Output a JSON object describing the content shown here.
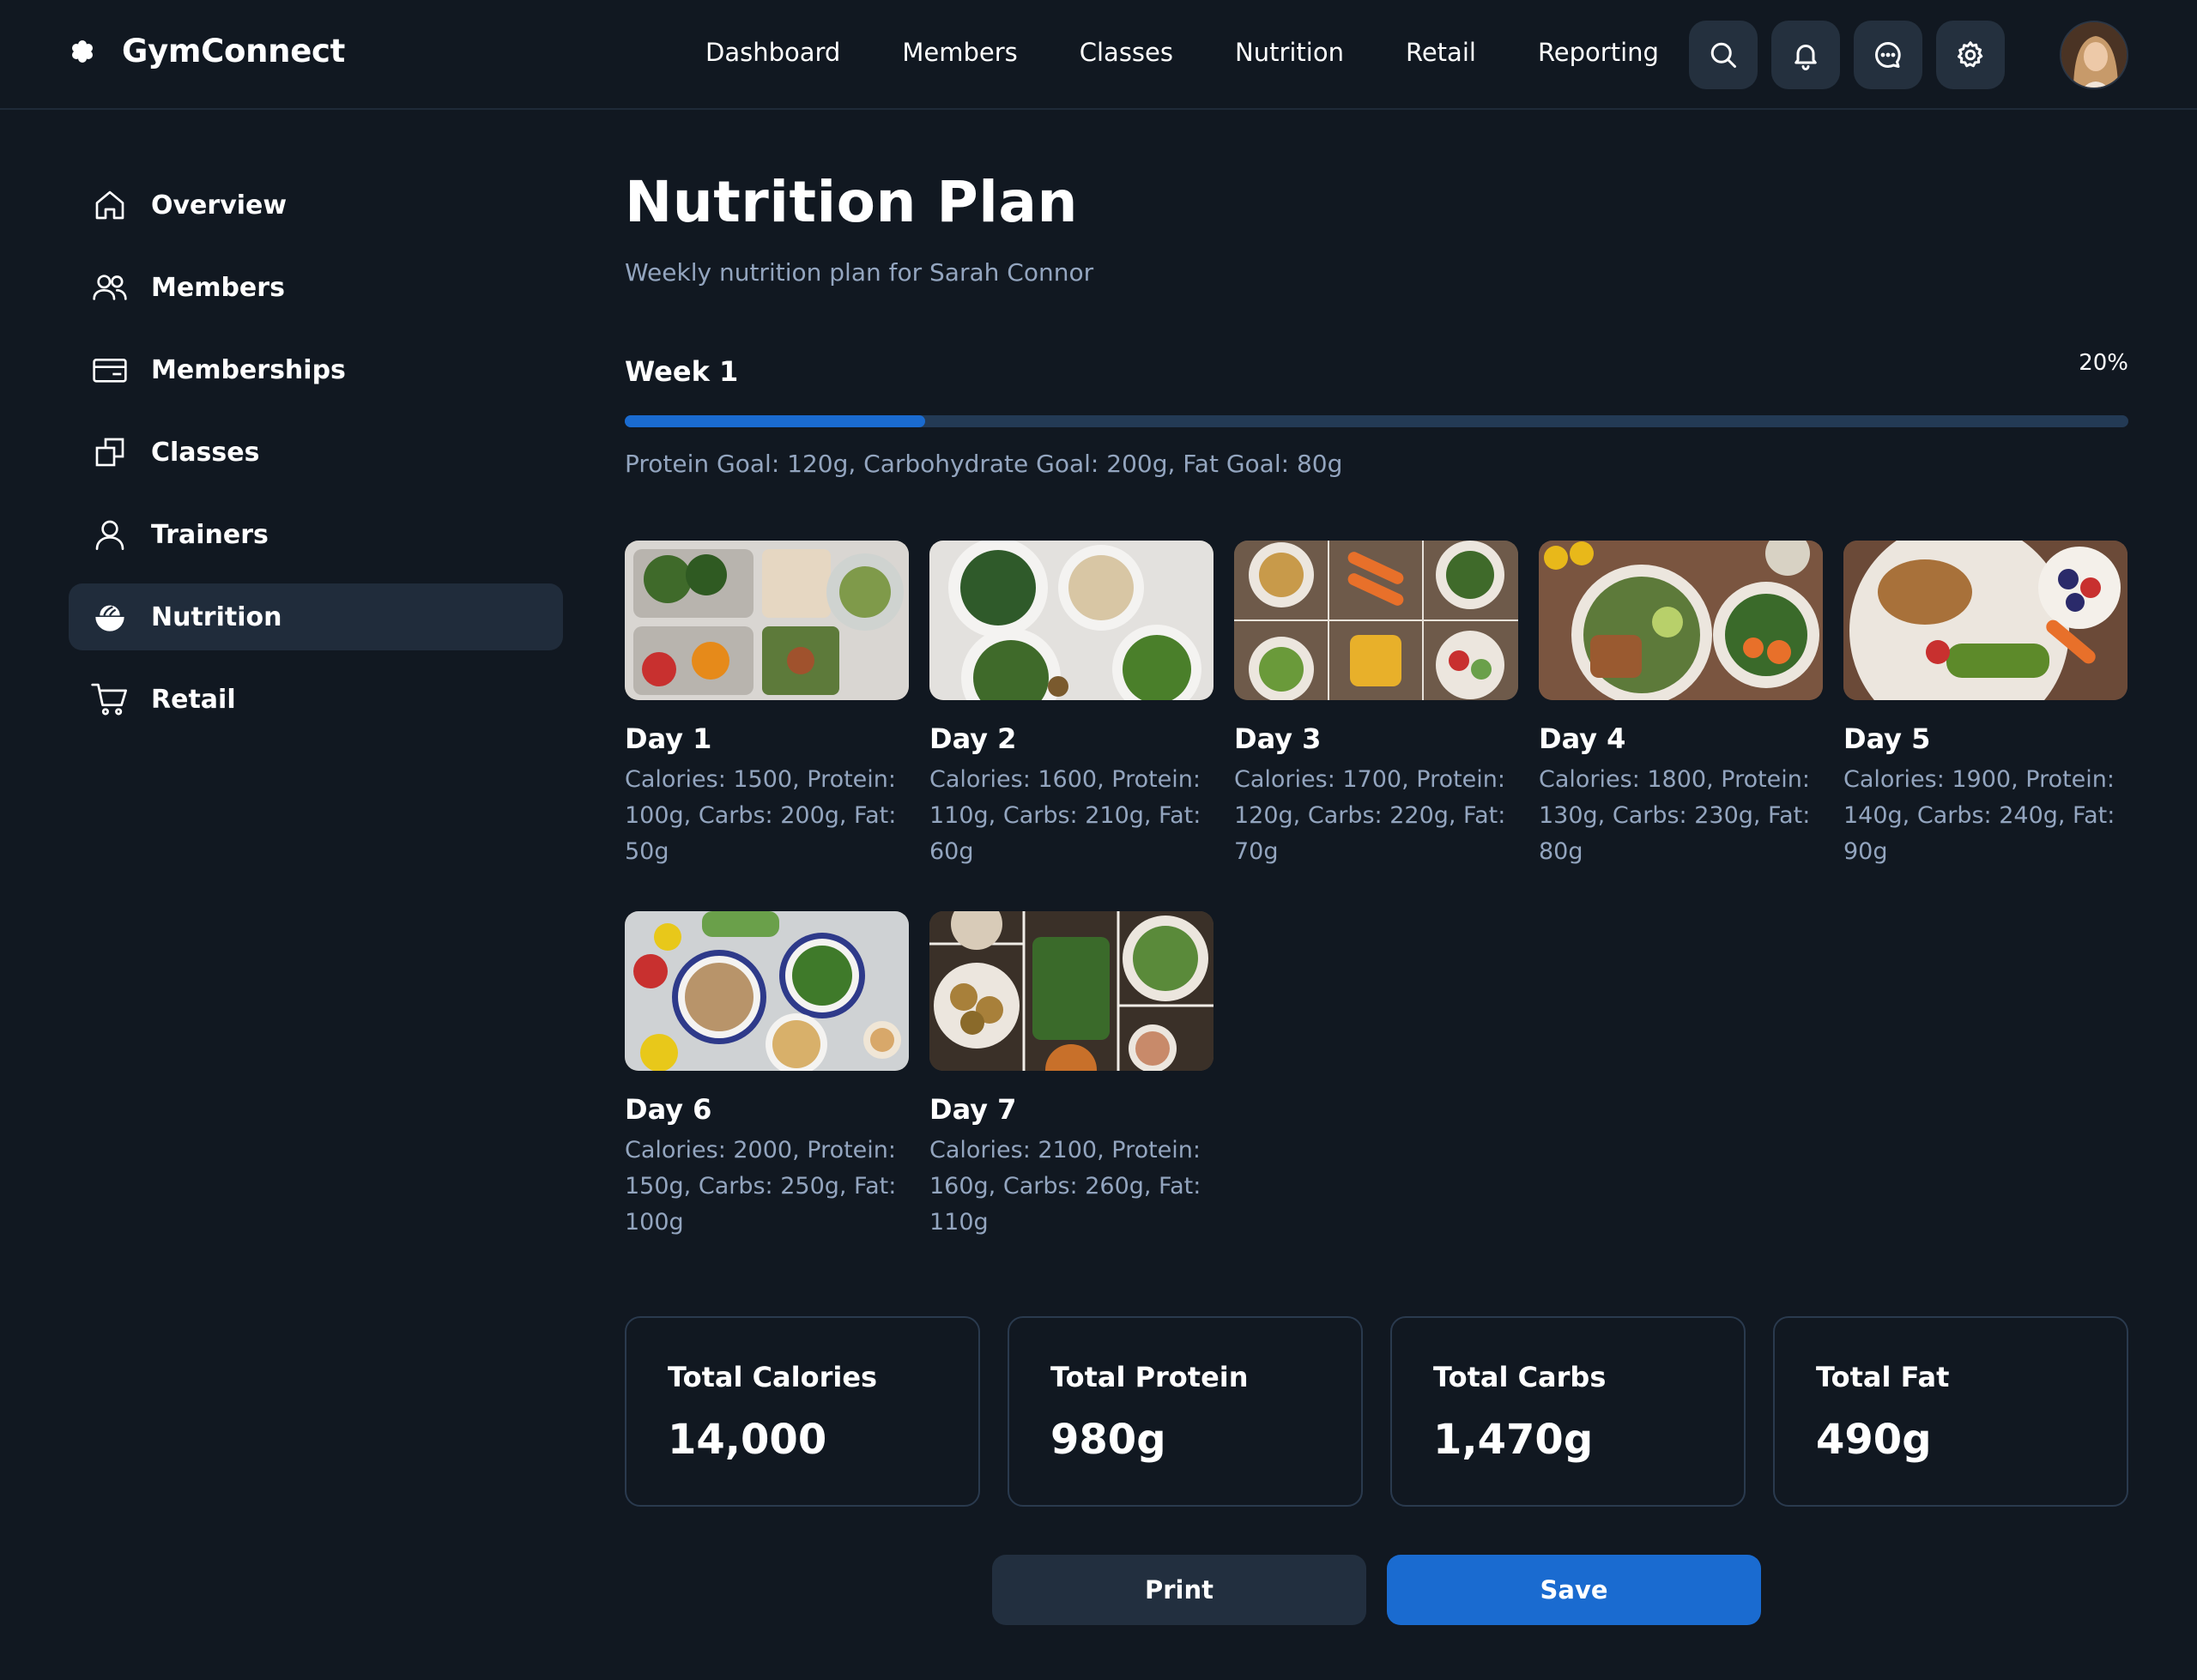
{
  "app": {
    "name": "GymConnect",
    "logo_icon": "asterisk-icon"
  },
  "topnav": [
    {
      "label": "Dashboard"
    },
    {
      "label": "Members"
    },
    {
      "label": "Classes"
    },
    {
      "label": "Nutrition"
    },
    {
      "label": "Retail"
    },
    {
      "label": "Reporting"
    }
  ],
  "topbar_actions": [
    "search-icon",
    "bell-icon",
    "chat-icon",
    "gear-icon"
  ],
  "sidebar": {
    "items": [
      {
        "label": "Overview",
        "icon": "home-icon"
      },
      {
        "label": "Members",
        "icon": "users-icon"
      },
      {
        "label": "Memberships",
        "icon": "card-icon"
      },
      {
        "label": "Classes",
        "icon": "copy-icon"
      },
      {
        "label": "Trainers",
        "icon": "user-icon"
      },
      {
        "label": "Nutrition",
        "icon": "bowl-icon",
        "active": true
      },
      {
        "label": "Retail",
        "icon": "cart-icon"
      }
    ]
  },
  "page": {
    "title": "Nutrition Plan",
    "subtitle": "Weekly nutrition plan for Sarah Connor",
    "week_label": "Week 1",
    "progress_text": "20%",
    "progress_value": 0.2,
    "goals": "Protein Goal: 120g, Carbohydrate Goal: 200g, Fat Goal: 80g"
  },
  "days": [
    {
      "name": "Day 1",
      "desc": "Calories: 1500, Protein: 100g, Carbs: 200g, Fat: 50g"
    },
    {
      "name": "Day 2",
      "desc": "Calories: 1600, Protein: 110g, Carbs: 210g, Fat: 60g"
    },
    {
      "name": "Day 3",
      "desc": "Calories: 1700, Protein: 120g, Carbs: 220g, Fat: 70g"
    },
    {
      "name": "Day 4",
      "desc": "Calories: 1800, Protein: 130g, Carbs: 230g, Fat: 80g"
    },
    {
      "name": "Day 5",
      "desc": "Calories: 1900, Protein: 140g, Carbs: 240g, Fat: 90g"
    },
    {
      "name": "Day 6",
      "desc": "Calories: 2000, Protein: 150g, Carbs: 250g, Fat: 100g"
    },
    {
      "name": "Day 7",
      "desc": "Calories: 2100, Protein: 160g, Carbs: 260g, Fat: 110g"
    }
  ],
  "totals": [
    {
      "label": "Total Calories",
      "value": "14,000"
    },
    {
      "label": "Total Protein",
      "value": "980g"
    },
    {
      "label": "Total Carbs",
      "value": "1,470g"
    },
    {
      "label": "Total Fat",
      "value": "490g"
    }
  ],
  "actions": {
    "print_label": "Print",
    "save_label": "Save"
  },
  "colors": {
    "background": "#111821",
    "accent": "#1a6bd0",
    "muted_text": "#93a5bf",
    "panel": "#202c3b"
  }
}
